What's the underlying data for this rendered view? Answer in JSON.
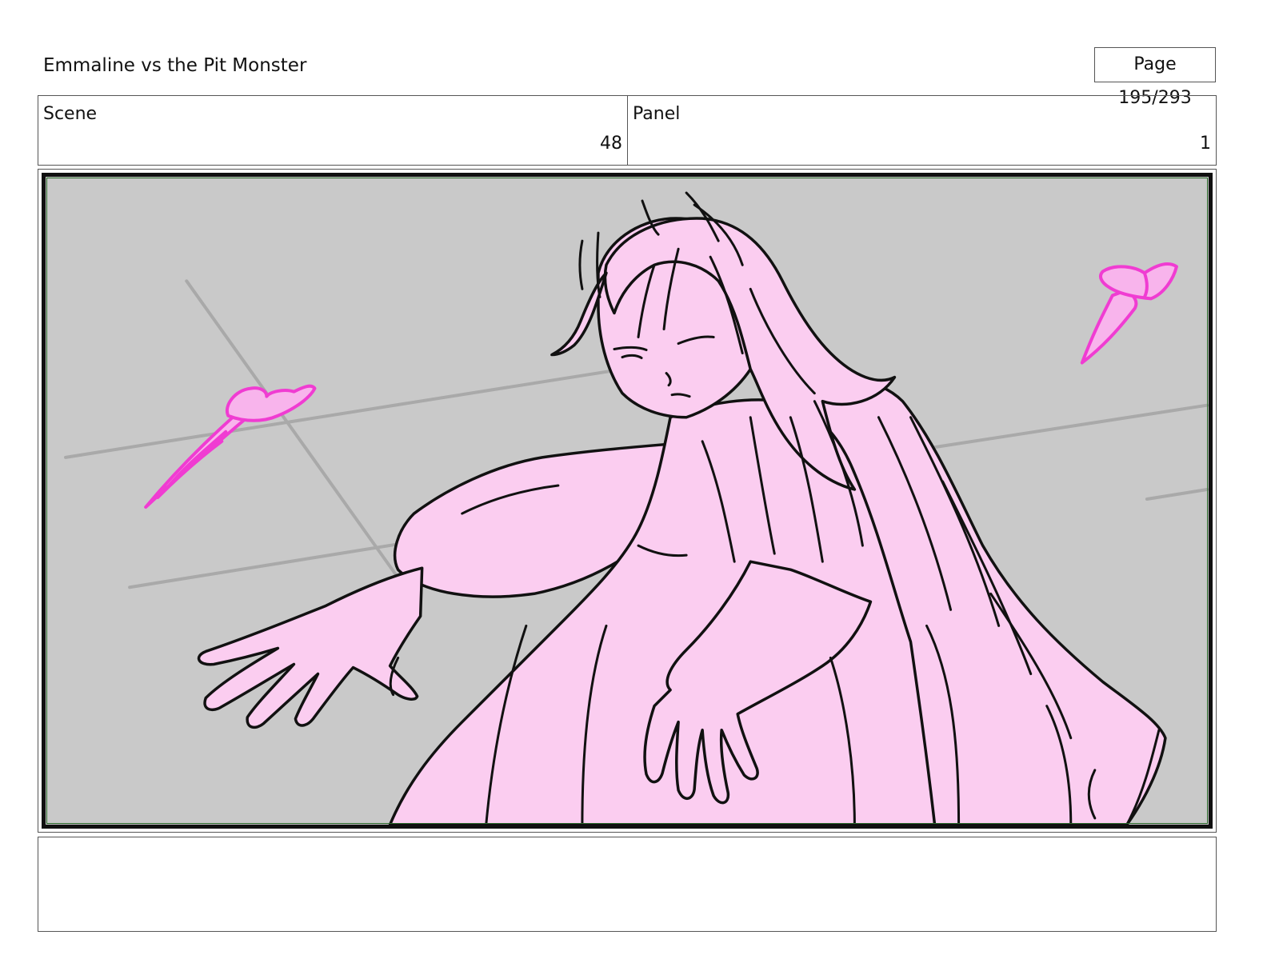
{
  "header": {
    "title": "Emmaline vs the Pit Monster",
    "page_label": "Page 195/293"
  },
  "info": {
    "scene_label": "Scene",
    "scene_value": "48",
    "panel_label": "Panel",
    "panel_value": "1"
  },
  "colors": {
    "background_gray": "#c9c9c9",
    "figure_fill": "#fbcdf0",
    "magic_shard": "#f03cd2",
    "line_art": "#111111"
  },
  "notes": {
    "text": ""
  }
}
